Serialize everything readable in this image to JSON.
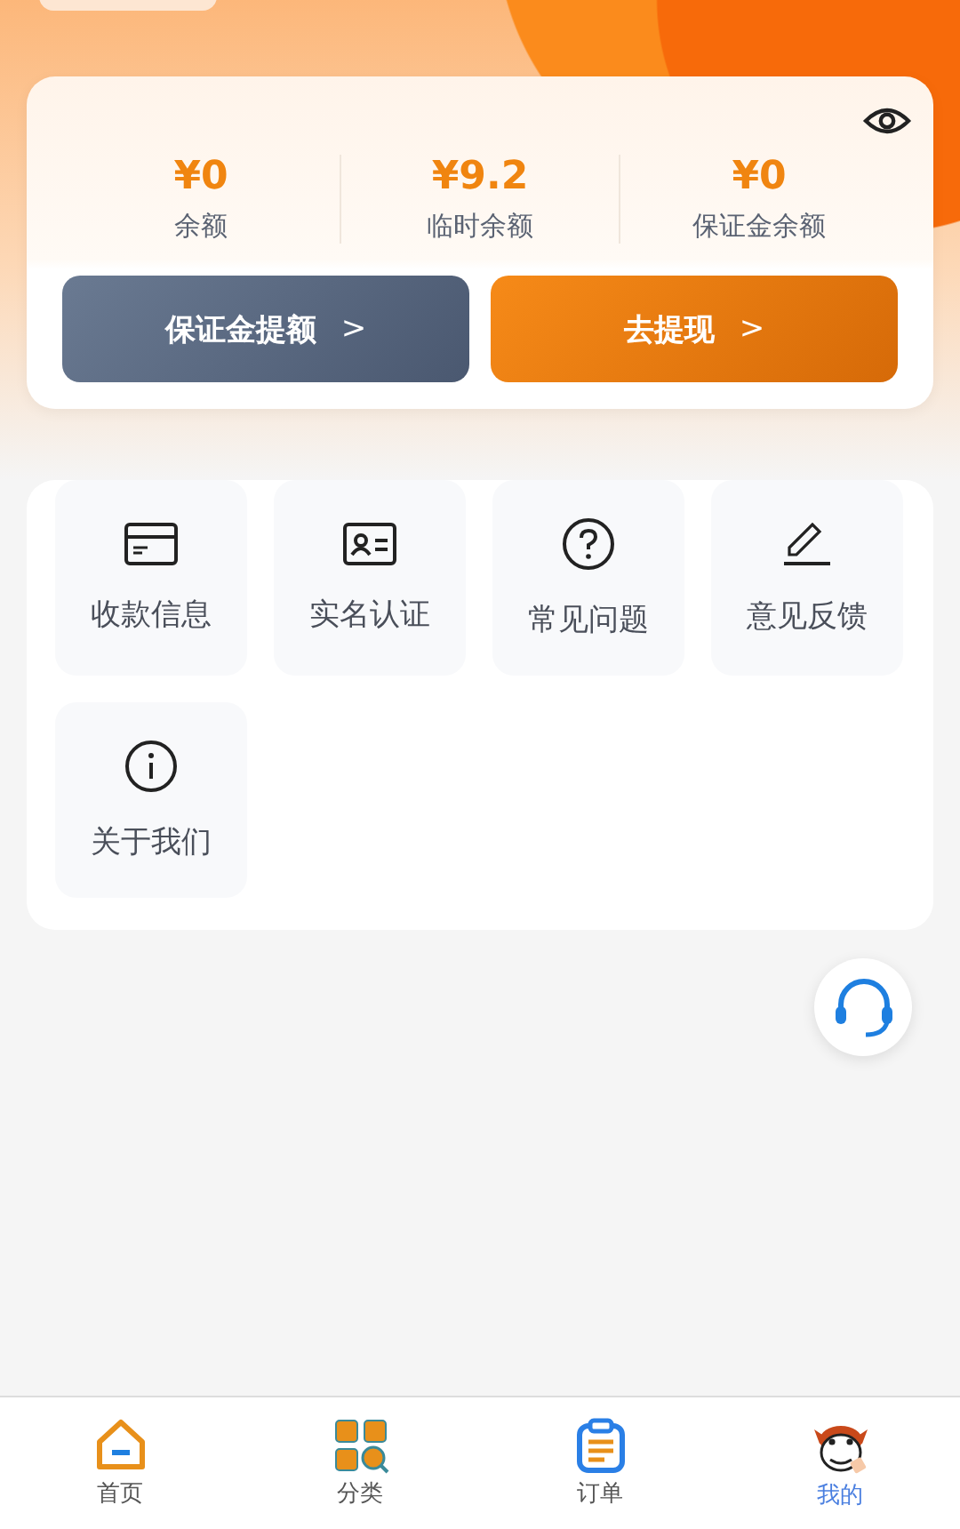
{
  "balances": [
    {
      "amount": "¥0",
      "label": "余额"
    },
    {
      "amount": "¥9.2",
      "label": "临时余额"
    },
    {
      "amount": "¥0",
      "label": "保证金余额"
    }
  ],
  "actions": [
    {
      "kind": "secondary",
      "label": "保证金提额",
      "arrow": ">"
    },
    {
      "kind": "primary",
      "label": "去提现",
      "arrow": ">"
    }
  ],
  "services": [
    {
      "kind": "card",
      "label": "收款信息"
    },
    {
      "kind": "id",
      "label": "实名认证"
    },
    {
      "kind": "question",
      "label": "常见问题"
    },
    {
      "kind": "edit",
      "label": "意见反馈"
    },
    {
      "kind": "info",
      "label": "关于我们"
    }
  ],
  "tabs": [
    {
      "kind": "home",
      "label": "首页",
      "selected": false
    },
    {
      "kind": "category",
      "label": "分类",
      "selected": false
    },
    {
      "kind": "order",
      "label": "订单",
      "selected": false
    },
    {
      "kind": "mine",
      "label": "我的",
      "selected": true
    }
  ]
}
